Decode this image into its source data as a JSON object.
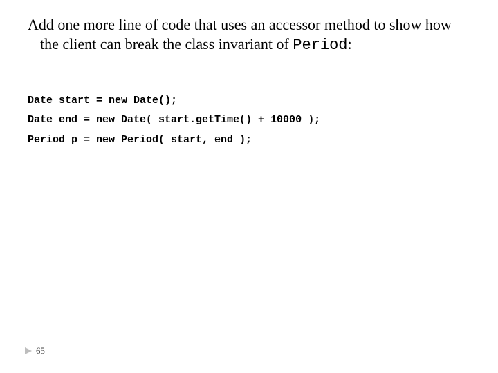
{
  "prompt": {
    "text_before_code": "Add one more line of code that uses an accessor method to show how the client can break the class invariant of ",
    "code_word": "Period",
    "text_after_code": ":"
  },
  "code": {
    "line1": "Date start = new Date();",
    "line2": "Date end = new Date( start.getTime() + 10000 );",
    "line3": "Period p = new Period( start, end );"
  },
  "footer": {
    "page_number": "65"
  }
}
